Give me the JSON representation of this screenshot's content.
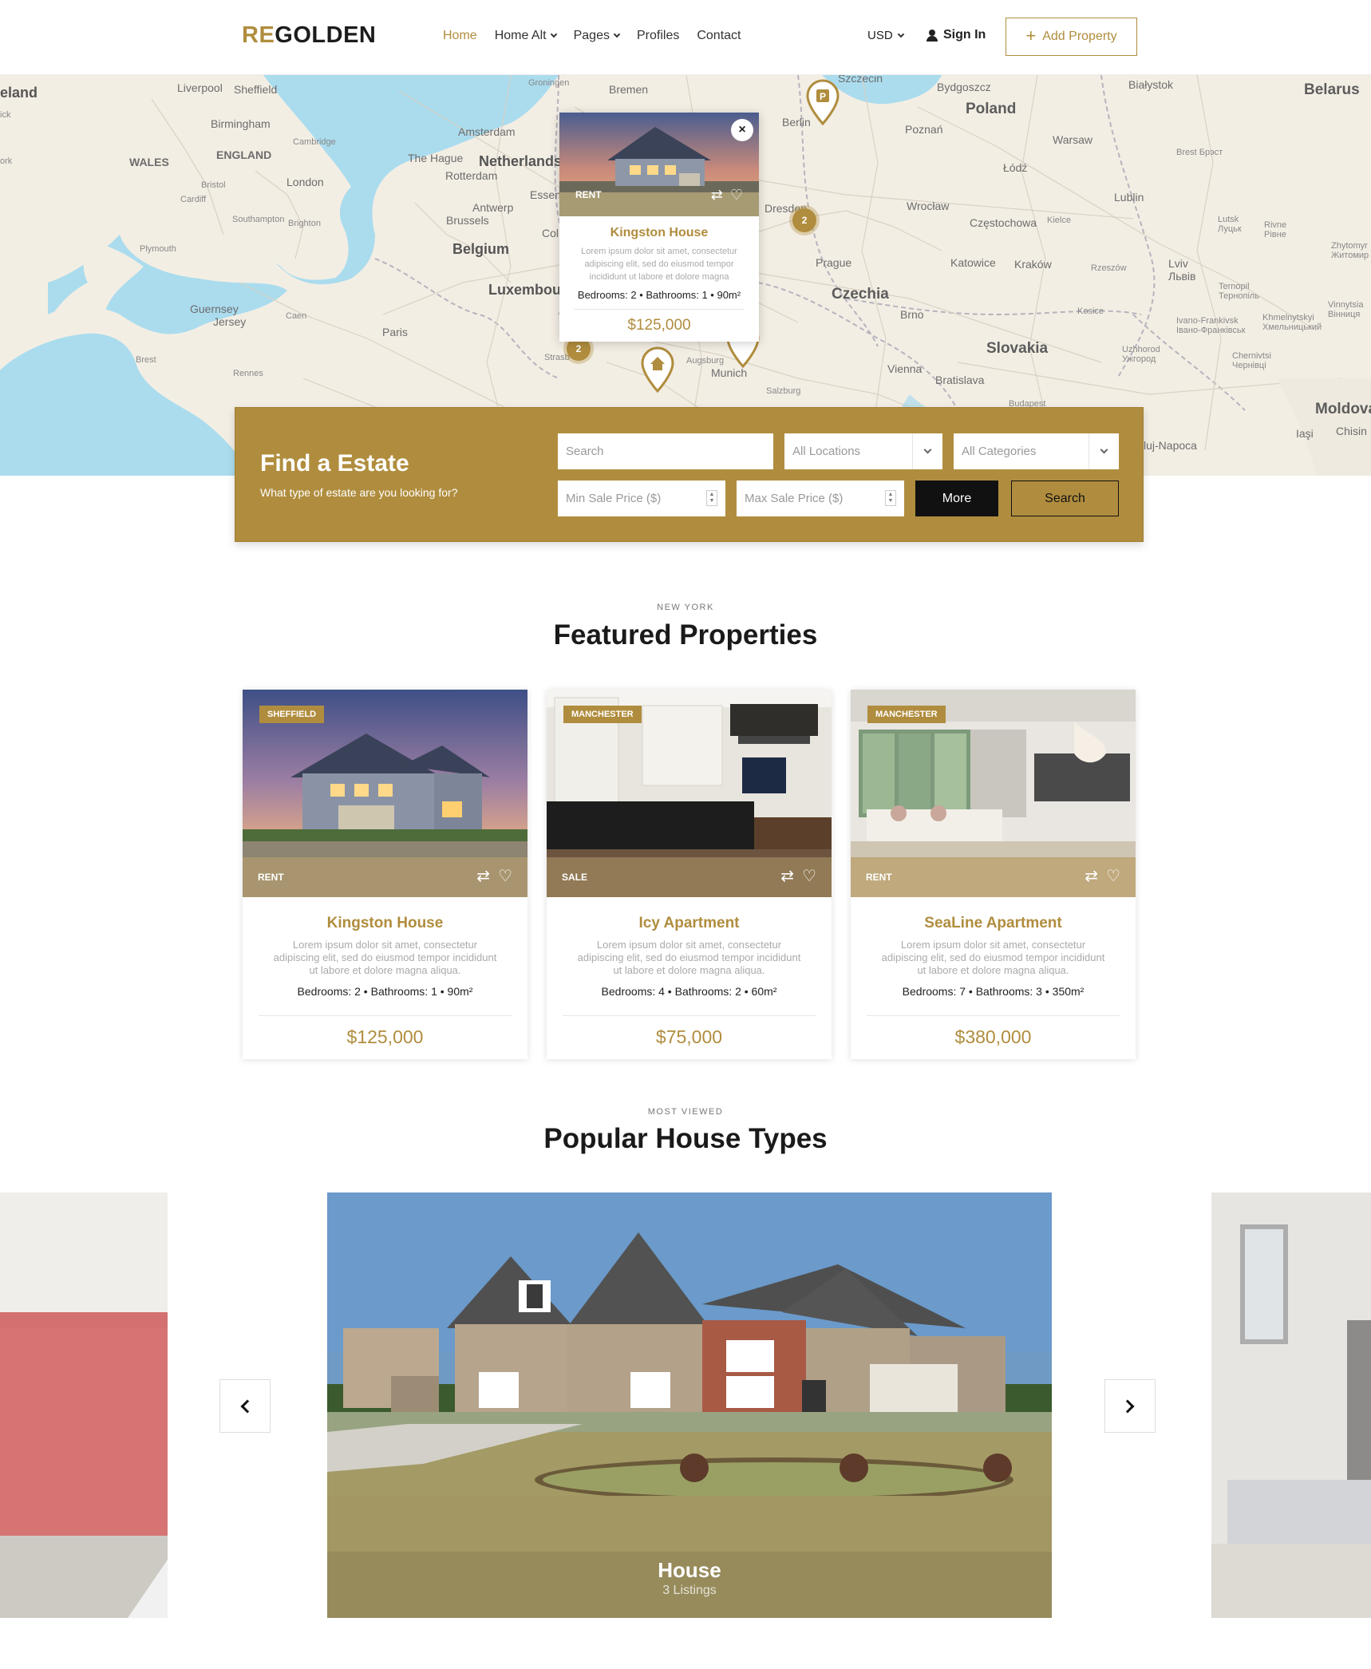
{
  "brand": {
    "logo_accent": "RE",
    "logo_main": "GOLDEN",
    "accent_color": "#b08d3e"
  },
  "nav": {
    "items": [
      {
        "label": "Home",
        "active": true,
        "dropdown": false
      },
      {
        "label": "Home Alt",
        "active": false,
        "dropdown": true
      },
      {
        "label": "Pages",
        "active": false,
        "dropdown": true
      },
      {
        "label": "Profiles",
        "active": false,
        "dropdown": false
      },
      {
        "label": "Contact",
        "active": false,
        "dropdown": false
      }
    ],
    "currency": "USD",
    "sign_in": "Sign In",
    "add_property": "Add Property"
  },
  "map": {
    "labels": [
      "eland",
      "Liverpool",
      "Sheffield",
      "Birmingham",
      "Cambridge",
      "WALES",
      "ENGLAND",
      "London",
      "Bristol",
      "Cardiff",
      "Southampton",
      "Brighton",
      "Plymouth",
      "Guernsey",
      "Jersey",
      "Caen",
      "Brest",
      "Rennes",
      "Paris",
      "The Hague",
      "Rotterdam",
      "Amsterdam",
      "Netherlands",
      "Groningen",
      "Bremen",
      "Antwerp",
      "Brussels",
      "Belgium",
      "Luxembou",
      "Essen",
      "Col",
      "Strasb",
      "Augsburg",
      "Munich",
      "Salzburg",
      "Berlin",
      "Dresden",
      "Szczecin",
      "Bydgoszcz",
      "Poland",
      "Poznań",
      "Warsaw",
      "Łódź",
      "Wrocław",
      "Częstochowa",
      "Kielce",
      "Lublin",
      "Prague",
      "Czechia",
      "Katowice",
      "Kraków",
      "Rzeszów",
      "Brno",
      "Slovakia",
      "Vienna",
      "Bratislava",
      "Budapest",
      "Białystok",
      "Brest Брэст",
      "Belarus",
      "Lutsk Луцьк",
      "Rivne Рівне",
      "Zhytomyr Житомир",
      "Lviv Львів",
      "Ternopil Тернопіль",
      "Ivano-Frankivsk Івано-Франківськ",
      "Khmelnytskyi Хмельницький",
      "Vinnytsia Вінниця",
      "Uzhhorod Ужгород",
      "Chernivtsi Чернівці",
      "Moldova",
      "Chisin",
      "luj-Napoca",
      "Iaşi",
      "ork",
      "ick",
      "Kosice"
    ],
    "popup": {
      "title": "Kingston House",
      "tag": "RENT",
      "description": "Lorem ipsum dolor sit amet, consectetur adipiscing elit, sed do eiusmod tempor incididunt ut labore et dolore magna aliqua.",
      "features": "Bedrooms: 2  •  Bathrooms: 1  •  90m²",
      "price": "$125,000",
      "close": "×"
    },
    "clusters": [
      "2",
      "2"
    ]
  },
  "search": {
    "title": "Find a Estate",
    "subtitle": "What type of estate are you looking for?",
    "keyword_placeholder": "Search",
    "location_default": "All Locations",
    "category_default": "All Categories",
    "min_price_placeholder": "Min Sale Price  ($)",
    "max_price_placeholder": "Max Sale Price  ($)",
    "more_label": "More",
    "search_label": "Search"
  },
  "featured": {
    "eyebrow": "NEW YORK",
    "title": "Featured Properties",
    "cards": [
      {
        "city": "SHEFFIELD",
        "tag": "RENT",
        "title": "Kingston House",
        "description": "Lorem ipsum dolor sit amet, consectetur adipiscing elit, sed do eiusmod tempor incididunt ut labore et dolore magna aliqua.",
        "features": "Bedrooms: 2  •  Bathrooms: 1  •  90m²",
        "price": "$125,000"
      },
      {
        "city": "MANCHESTER",
        "tag": "SALE",
        "title": "Icy Apartment",
        "description": "Lorem ipsum dolor sit amet, consectetur adipiscing elit, sed do eiusmod tempor incididunt ut labore et dolore magna aliqua.",
        "features": "Bedrooms: 4  •  Bathrooms: 2  •  60m²",
        "price": "$75,000"
      },
      {
        "city": "MANCHESTER",
        "tag": "RENT",
        "title": "SeaLine Apartment",
        "description": "Lorem ipsum dolor sit amet, consectetur adipiscing elit, sed do eiusmod tempor incididunt ut labore et dolore magna aliqua.",
        "features": "Bedrooms: 7  •  Bathrooms: 3  •  350m²",
        "price": "$380,000"
      }
    ]
  },
  "popular": {
    "eyebrow": "MOST VIEWED",
    "title": "Popular House Types",
    "active_slide": {
      "title": "House",
      "count": "3 Listings"
    }
  }
}
